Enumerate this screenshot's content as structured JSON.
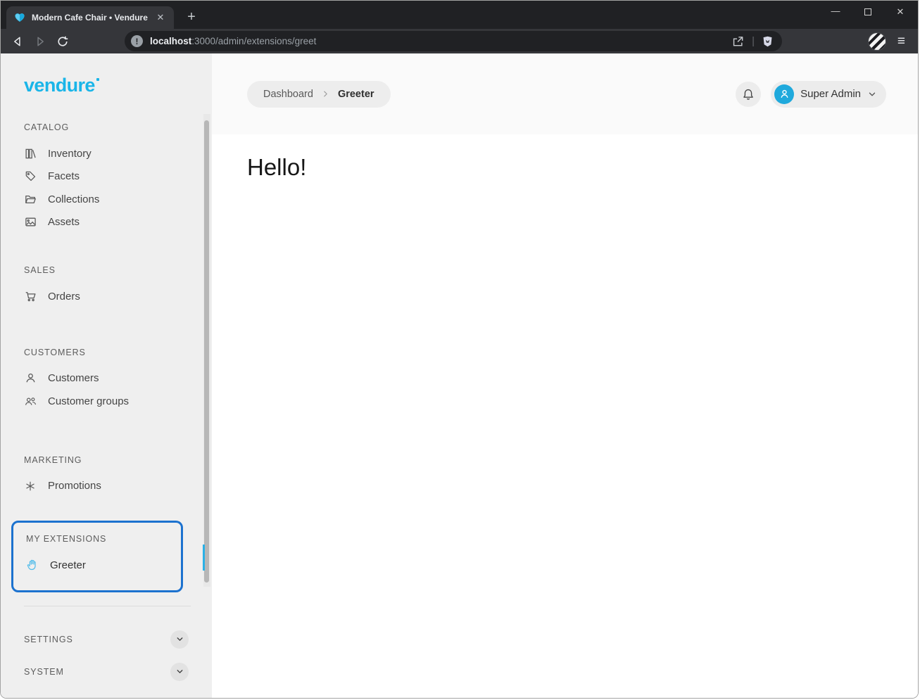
{
  "browser": {
    "tab_title": "Modern Cafe Chair • Vendure",
    "url": {
      "host": "localhost",
      "rest": ":3000/admin/extensions/greet"
    },
    "icons": {
      "close_tab": "✕",
      "new_tab": "+",
      "minimize": "—",
      "close_window": "✕",
      "hamburger": "≡",
      "url_separator": "|"
    }
  },
  "admin": {
    "logo": "vendure",
    "breadcrumb": {
      "items": [
        "Dashboard",
        "Greeter"
      ]
    },
    "user_menu": "Super Admin",
    "content_heading": "Hello!",
    "sections": [
      {
        "label": "CATALOG",
        "items": [
          {
            "label": "Inventory",
            "icon": "library-icon"
          },
          {
            "label": "Facets",
            "icon": "tag-icon"
          },
          {
            "label": "Collections",
            "icon": "folder-icon"
          },
          {
            "label": "Assets",
            "icon": "image-icon"
          }
        ]
      },
      {
        "label": "SALES",
        "items": [
          {
            "label": "Orders",
            "icon": "cart-icon"
          }
        ]
      },
      {
        "label": "CUSTOMERS",
        "items": [
          {
            "label": "Customers",
            "icon": "user-icon"
          },
          {
            "label": "Customer groups",
            "icon": "users-icon"
          }
        ]
      },
      {
        "label": "MARKETING",
        "items": [
          {
            "label": "Promotions",
            "icon": "asterisk-icon"
          }
        ]
      },
      {
        "label": "MY EXTENSIONS",
        "highlighted": true,
        "items": [
          {
            "label": "Greeter",
            "icon": "hand-icon"
          }
        ]
      },
      {
        "label": "SETTINGS",
        "collapsed": true
      },
      {
        "label": "SYSTEM",
        "collapsed": true
      }
    ],
    "colors": {
      "brand": "#1ab5e8",
      "highlight_border": "#1c72cf",
      "avatar": "#1fa9dc",
      "active_indicator": "#2bb1e6"
    }
  }
}
